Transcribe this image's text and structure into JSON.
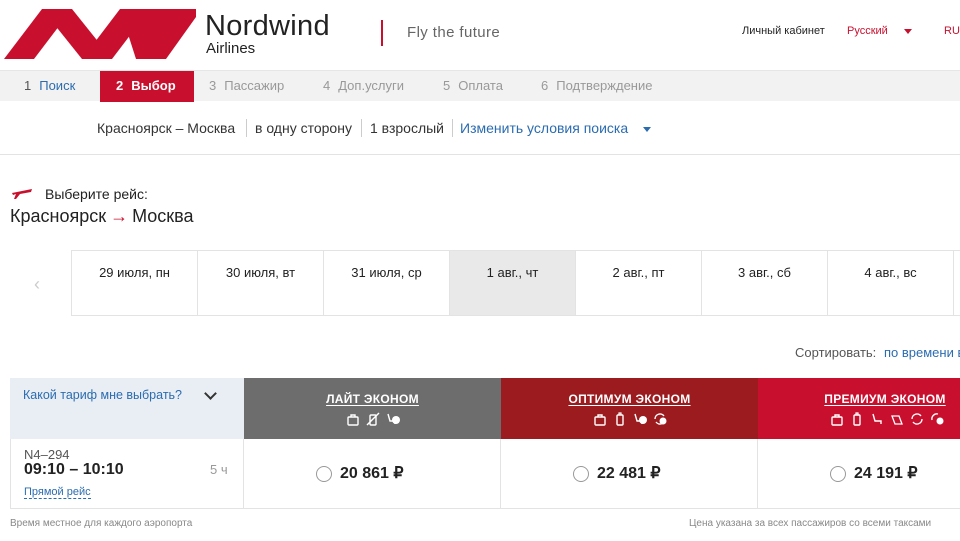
{
  "header": {
    "brand_name": "Nordwind",
    "brand_sub": "Airlines",
    "tagline": "Fly the future",
    "account": "Личный кабинет",
    "language": "Русский",
    "currency": "RUB"
  },
  "steps": [
    {
      "num": "1",
      "label": "Поиск",
      "state": "done"
    },
    {
      "num": "2",
      "label": "Выбор",
      "state": "active"
    },
    {
      "num": "3",
      "label": "Пассажир",
      "state": "pending"
    },
    {
      "num": "4",
      "label": "Доп.услуги",
      "state": "pending"
    },
    {
      "num": "5",
      "label": "Оплата",
      "state": "pending"
    },
    {
      "num": "6",
      "label": "Подтверждение",
      "state": "pending"
    }
  ],
  "summary": {
    "route": "Красноярск – Москва",
    "trip_type": "в одну сторону",
    "passengers": "1 взрослый",
    "change_link": "Изменить условия поиска"
  },
  "heading": {
    "choose": "Выберите рейс:",
    "from": "Красноярск",
    "arrow": "→",
    "to": "Москва"
  },
  "dates": [
    {
      "label": "29 июля, пн"
    },
    {
      "label": "30 июля, вт"
    },
    {
      "label": "31 июля, ср"
    },
    {
      "label": "1 авг., чт",
      "selected": true
    },
    {
      "label": "2 авг., пт"
    },
    {
      "label": "3 авг., сб"
    },
    {
      "label": "4 авг., вс"
    }
  ],
  "sort": {
    "label": "Сортировать:",
    "value": "по времени вылета"
  },
  "fare_help": "Какой тариф мне выбрать?",
  "tariffs": [
    {
      "name": "ЛАЙТ ЭКОНОМ",
      "color": "#6d6d6d",
      "icons": [
        "hand-baggage-icon",
        "no-baggage-icon",
        "paid-seat-icon"
      ]
    },
    {
      "name": "ОПТИМУМ ЭКОНОМ",
      "color": "#9b1b1f",
      "icons": [
        "hand-baggage-icon",
        "baggage-icon",
        "paid-seat-icon",
        "exchange-paid-icon"
      ]
    },
    {
      "name": "ПРЕМИУМ ЭКОНОМ",
      "color": "#c8102e",
      "icons": [
        "hand-baggage-icon",
        "baggage-icon",
        "seat-icon",
        "meal-icon",
        "exchange-icon",
        "refund-paid-icon"
      ]
    }
  ],
  "flight": {
    "number": "N4–294",
    "time": "09:10 – 10:10",
    "duration": "5 ч",
    "direct": "Прямой рейс",
    "prices": [
      "20 861 ₽",
      "22 481 ₽",
      "24 191 ₽"
    ]
  },
  "footnotes": {
    "left": "Время местное для каждого аэропорта",
    "right": "Цена указана за всех пассажиров со всеми таксами"
  },
  "colors": {
    "brand_red": "#c8102e",
    "link_blue": "#2b6cb0"
  }
}
